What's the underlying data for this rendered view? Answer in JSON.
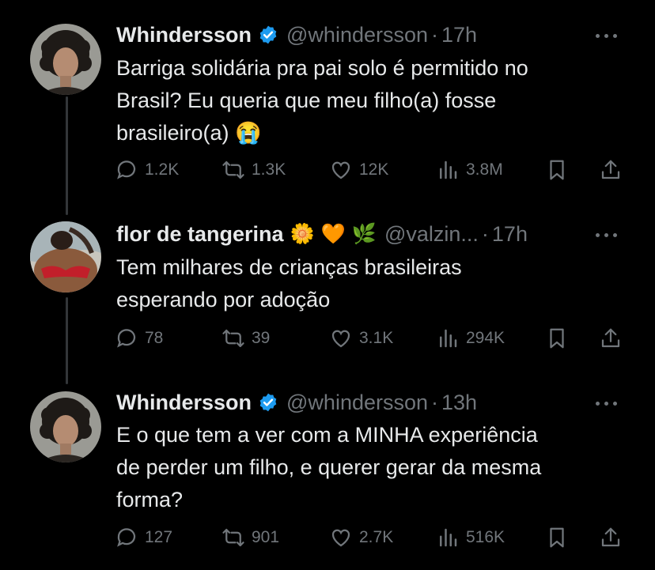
{
  "tweets": [
    {
      "name": "Whindersson",
      "handle": "@whindersson",
      "time": "17h",
      "lines": [
        "Barriga solidária pra pai solo é permitido no",
        "Brasil? Eu queria que meu filho(a) fosse",
        "brasileiro(a) 😭"
      ],
      "replies": "1.2K",
      "retweets": "1.3K",
      "likes": "12K",
      "views": "3.8M"
    },
    {
      "name": "flor de tangerina",
      "emojis": [
        "🌼",
        "🧡",
        "🌿"
      ],
      "handle": "@valzin...",
      "time": "17h",
      "lines": [
        "Tem milhares de crianças brasileiras",
        "esperando por adoção"
      ],
      "replies": "78",
      "retweets": "39",
      "likes": "3.1K",
      "views": "294K"
    },
    {
      "name": "Whindersson",
      "handle": "@whindersson",
      "time": "13h",
      "lines": [
        "E o que tem a ver com a MINHA experiência",
        "de perder um filho, e querer gerar da mesma",
        "forma?"
      ],
      "replies": "127",
      "retweets": "901",
      "likes": "2.7K",
      "views": "516K"
    }
  ],
  "separator": "·",
  "colors": {
    "background": "#000000",
    "text": "#e7e9ea",
    "muted": "#71767b",
    "verified": "#1d9bf0"
  },
  "icons": [
    "verified-badge-icon",
    "more-icon",
    "reply-icon",
    "retweet-icon",
    "like-icon",
    "views-icon",
    "bookmark-icon",
    "share-icon"
  ]
}
